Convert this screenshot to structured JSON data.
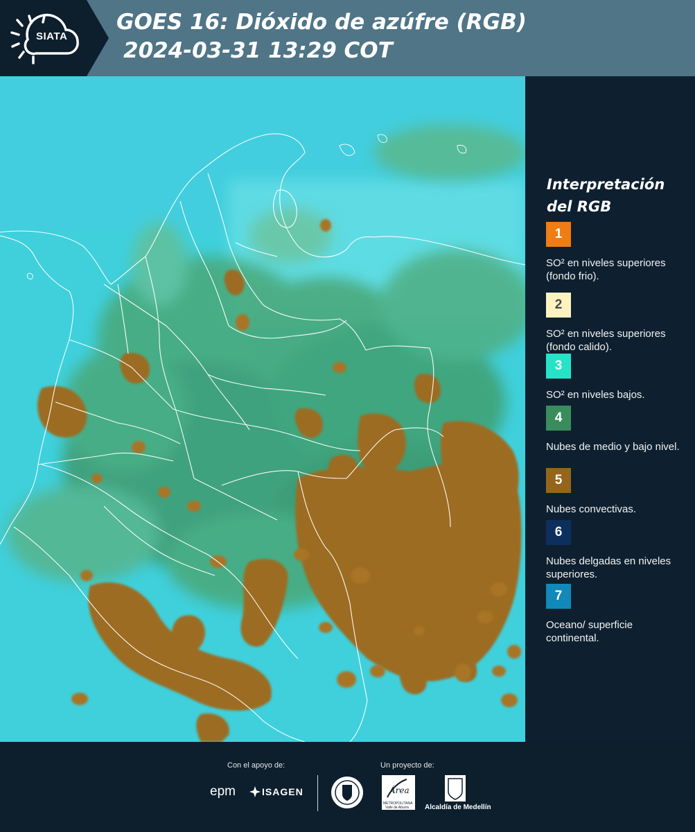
{
  "header": {
    "logo_text": "SIATA",
    "title_line1": "GOES 16: Dióxido de azúfre (RGB)",
    "title_line2": "2024-03-31 13:29 COT",
    "colors": {
      "dark": "#0d1f2d",
      "band": "#4f7587"
    }
  },
  "legend": {
    "title": "Interpretación del RGB",
    "items": [
      {
        "number": "1",
        "label": "SO² en niveles superiores (fondo frio).",
        "color": "#f07d12",
        "text_color": "#ffffff"
      },
      {
        "number": "2",
        "label": "SO² en niveles superiores (fondo calido).",
        "color": "#fdf3c0",
        "text_color": "#4a4a4a"
      },
      {
        "number": "3",
        "label": "SO² en niveles bajos.",
        "color": "#26e3c8",
        "text_color": "#ffffff"
      },
      {
        "number": "4",
        "label": "Nubes de medio y bajo nivel.",
        "color": "#3a8c5c",
        "text_color": "#ffffff"
      },
      {
        "number": "5",
        "label": "Nubes convectivas.",
        "color": "#96651c",
        "text_color": "#ffffff"
      },
      {
        "number": "6",
        "label": "Nubes delgadas en niveles superiores.",
        "color": "#0d2f5e",
        "text_color": "#ffffff"
      },
      {
        "number": "7",
        "label": "Oceano/ superficie continental.",
        "color": "#1289b8",
        "text_color": "#ffffff"
      }
    ]
  },
  "footer": {
    "support_caption": "Con el apoyo de:",
    "project_caption": "Un proyecto de:",
    "sponsors": [
      "epm",
      "ISAGEN"
    ],
    "metropolitana_text": "Área",
    "metropolitana_sub": "METROPOLITANA",
    "metropolitana_sub2": "Valle de Aburrá",
    "alcaldia_text": "Alcaldía de Medellín"
  }
}
